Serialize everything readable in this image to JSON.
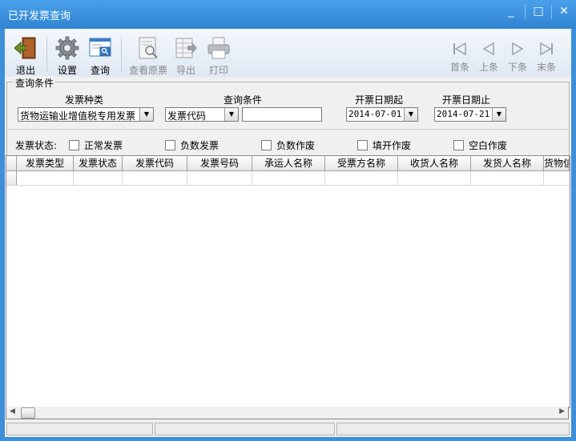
{
  "window": {
    "title": "已开发票查询",
    "controls": {
      "minimize": "_",
      "maximize": "□",
      "close": "✕"
    }
  },
  "toolbar": {
    "exit": "退出",
    "settings": "设置",
    "query": "查询",
    "view_original": "查看原票",
    "export": "导出",
    "print": "打印",
    "first": "首条",
    "prev": "上条",
    "next": "下条",
    "last": "末条"
  },
  "query_group": {
    "title": "查询条件",
    "invoice_type_label": "发票种类",
    "invoice_type_value": "货物运输业增值税专用发票",
    "condition_label": "查询条件",
    "condition_value": "发票代码",
    "condition_text": "",
    "date_from_label": "开票日期起",
    "date_from_value": "2014-07-01",
    "date_to_label": "开票日期止",
    "date_to_value": "2014-07-21",
    "status_label": "发票状态:",
    "status_options": [
      "正常发票",
      "负数发票",
      "负数作废",
      "填开作废",
      "空白作废"
    ]
  },
  "grid": {
    "columns": [
      "发票类型",
      "发票状态",
      "发票代码",
      "发票号码",
      "承运人名称",
      "受票方名称",
      "收货人名称",
      "发货人名称",
      "货物信"
    ]
  },
  "colors": {
    "title_bar": "#3d8fd9",
    "window_bg": "#f0f0f0",
    "exit_icon": "#6b8e23",
    "disabled_text": "#8a8a8a"
  },
  "icons": [
    "exit-icon",
    "gear-icon",
    "query-icon",
    "view-original-icon",
    "export-icon",
    "print-icon",
    "first-icon",
    "prev-icon",
    "next-icon",
    "last-icon"
  ]
}
